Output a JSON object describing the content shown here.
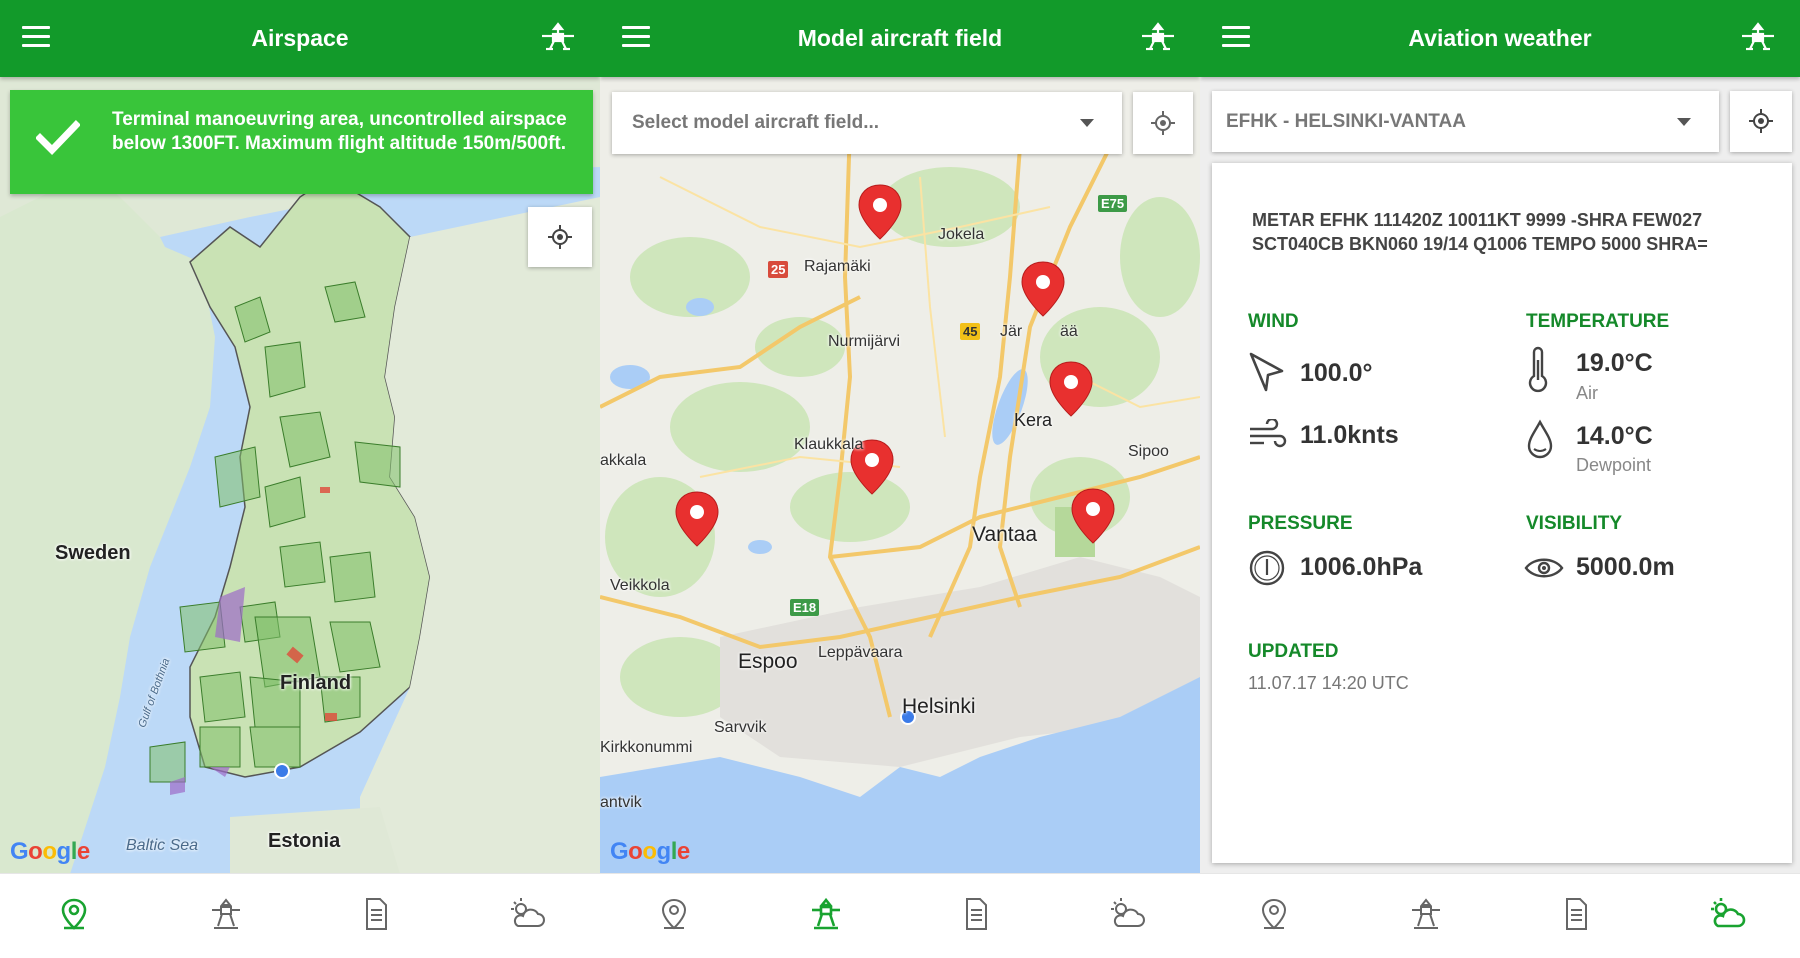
{
  "colors": {
    "primary": "#129a2a",
    "banner": "#39c53a",
    "accent_label": "#15892a",
    "pin": "#e8302f"
  },
  "panel1": {
    "title": "Airspace",
    "banner_text": "Terminal manoeuvring area, uncontrolled airspace below 1300FT. Maximum flight altitude 150m/500ft.",
    "map_labels": {
      "sweden": "Sweden",
      "finland": "Finland",
      "estonia": "Estonia",
      "baltic_sea": "Baltic Sea",
      "gulf": "Gulf of Bothnia"
    },
    "google": "Google"
  },
  "panel2": {
    "title": "Model aircraft field",
    "select_placeholder": "Select model aircraft field...",
    "map_labels": {
      "rajamaki": "Rajamäki",
      "jokela": "Jokela",
      "nurmijarvi": "Nurmijärvi",
      "jarvenpaa": "Jär",
      "jarvenpaa2": "ää",
      "kerava": "Kera",
      "sipoo": "Sipoo",
      "klaukkala": "Klaukkala",
      "vantaa": "Vantaa",
      "akkala": "akkala",
      "veikkola": "Veikkola",
      "espoo": "Espoo",
      "leppavaara": "Leppävaara",
      "helsinki": "Helsinki",
      "sarvvik": "Sarvvik",
      "kirkkonummi": "Kirkkonummi",
      "antvik": "antvik"
    },
    "road_shields": {
      "r25": "25",
      "r45": "45",
      "e75": "E75",
      "e18": "E18"
    },
    "google": "Google"
  },
  "panel3": {
    "title": "Aviation weather",
    "station": "EFHK - HELSINKI-VANTAA",
    "metar": "METAR EFHK 111420Z 10011KT 9999 -SHRA FEW027 SCT040CB BKN060 19/14 Q1006 TEMPO 5000 SHRA=",
    "wind": {
      "label": "WIND",
      "direction": "100.0°",
      "speed": "11.0knts"
    },
    "temperature": {
      "label": "TEMPERATURE",
      "air": "19.0°C",
      "air_caption": "Air",
      "dewpoint": "14.0°C",
      "dewpoint_caption": "Dewpoint"
    },
    "pressure": {
      "label": "PRESSURE",
      "value": "1006.0hPa"
    },
    "visibility": {
      "label": "VISIBILITY",
      "value": "5000.0m"
    },
    "updated": {
      "label": "UPDATED",
      "value": "11.07.17 14:20 UTC"
    }
  },
  "bottom_nav": {
    "items": [
      "map-pin-icon",
      "drone-icon",
      "document-icon",
      "weather-icon"
    ],
    "active_panel1": 0,
    "active_panel2": 1,
    "active_panel3": 3
  }
}
